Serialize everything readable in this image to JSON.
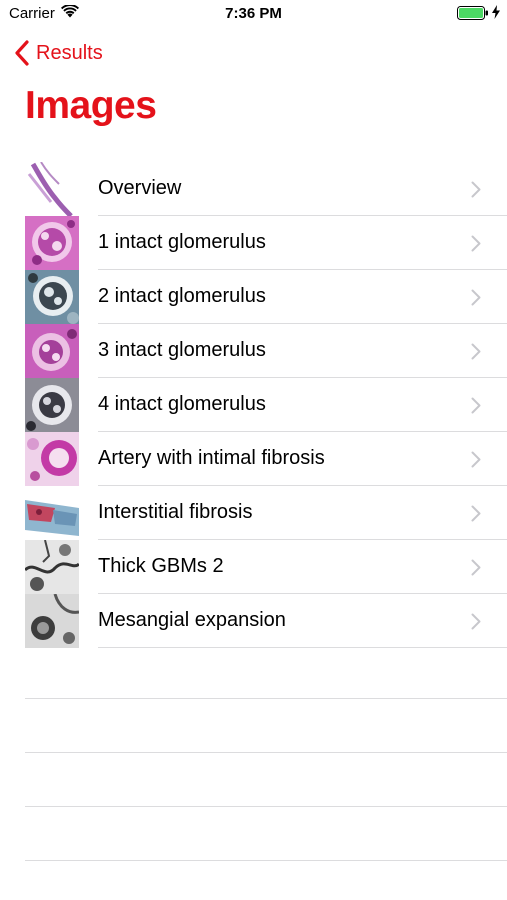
{
  "status_bar": {
    "carrier": "Carrier",
    "time": "7:36 PM",
    "battery_color": "#4cd964"
  },
  "nav": {
    "back_label": "Results",
    "title": "Images",
    "accent_color": "#e4121a"
  },
  "items": [
    {
      "label": "Overview",
      "thumb": "overview-thumbnail"
    },
    {
      "label": "1 intact glomerulus",
      "thumb": "glomerulus-thumbnail"
    },
    {
      "label": "2 intact glomerulus",
      "thumb": "glomerulus-thumbnail"
    },
    {
      "label": "3 intact glomerulus",
      "thumb": "glomerulus-thumbnail"
    },
    {
      "label": "4 intact glomerulus",
      "thumb": "glomerulus-thumbnail"
    },
    {
      "label": "Artery with intimal fibrosis",
      "thumb": "artery-thumbnail"
    },
    {
      "label": "Interstitial fibrosis",
      "thumb": "fibrosis-thumbnail"
    },
    {
      "label": "Thick GBMs 2",
      "thumb": "electron-micrograph-thumbnail"
    },
    {
      "label": "Mesangial expansion",
      "thumb": "electron-micrograph-thumbnail"
    }
  ]
}
